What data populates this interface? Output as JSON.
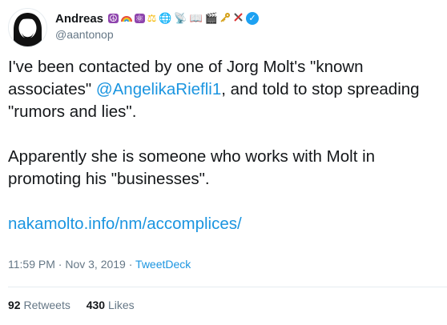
{
  "user": {
    "display_name": "Andreas",
    "handle": "@aantonop",
    "badges": [
      "peace-icon",
      "rainbow-icon",
      "atom-icon",
      "scales-icon",
      "globe-icon",
      "satellite-icon",
      "book-icon",
      "camera-icon",
      "key-icon",
      "tools-icon"
    ],
    "verified_color": "#1da1f2"
  },
  "tweet": {
    "para1_a": "I've been contacted by one of Jorg Molt's \"known associates\" ",
    "para1_mention": "@AngelikaRiefli1",
    "para1_b": ", and told to stop spreading \"rumors and lies\".",
    "para2": "Apparently she is someone who works with Molt in promoting his \"businesses\".",
    "link": "nakamolto.info/nm/accomplices/",
    "time": "11:59 PM",
    "sep": " · ",
    "date": "Nov 3, 2019",
    "sep2": " · ",
    "source": "TweetDeck"
  },
  "stats": {
    "retweets_count": "92",
    "retweets_label": "Retweets",
    "likes_count": "430",
    "likes_label": "Likes"
  },
  "colors": {
    "link": "#1b95e0",
    "muted": "#657786",
    "text": "#14171a"
  }
}
